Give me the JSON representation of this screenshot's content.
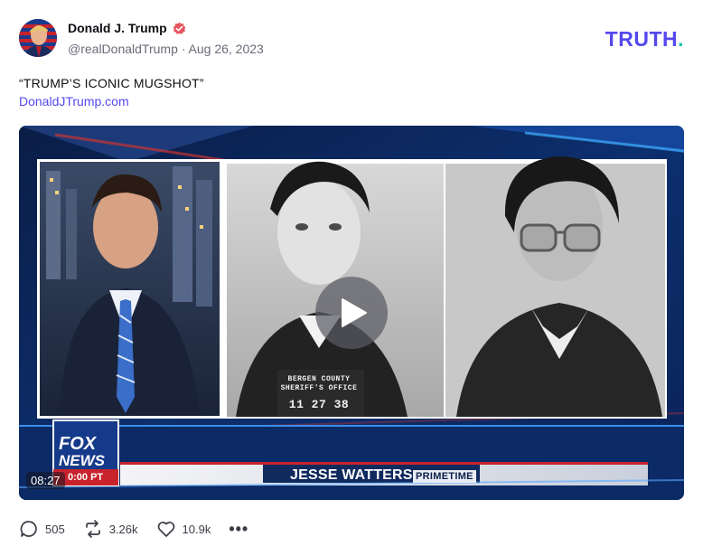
{
  "post": {
    "author_name": "Donald J. Trump",
    "handle_and_date": "@realDonaldTrump · Aug 26, 2023",
    "text": "“TRUMP’S ICONIC MUGSHOT”",
    "link": "DonaldJTrump.com"
  },
  "brand": {
    "logo_main": "TRUTH",
    "logo_dot": ".",
    "color_primary": "#5448ee",
    "color_accent": "#16c7a5"
  },
  "video": {
    "duration": "08:27",
    "chyron_show": "JESSE WATTERS",
    "chyron_sub": "PRIMETIME",
    "network_top": "FOX",
    "network_bottom": "NEWS",
    "network_time": "0:00 PT",
    "sign_line_1": "BERGEN COUNTY",
    "sign_line_2": "SHERIFF'S OFFICE",
    "sign_number": "11  27  38"
  },
  "actions": {
    "replies": "505",
    "retruths": "3.26k",
    "likes": "10.9k",
    "more": "•••"
  },
  "icons": {
    "verified": "verified-badge-icon",
    "reply": "reply-icon",
    "retruth": "retruth-icon",
    "like": "heart-icon",
    "more": "more-icon",
    "play": "play-icon"
  }
}
